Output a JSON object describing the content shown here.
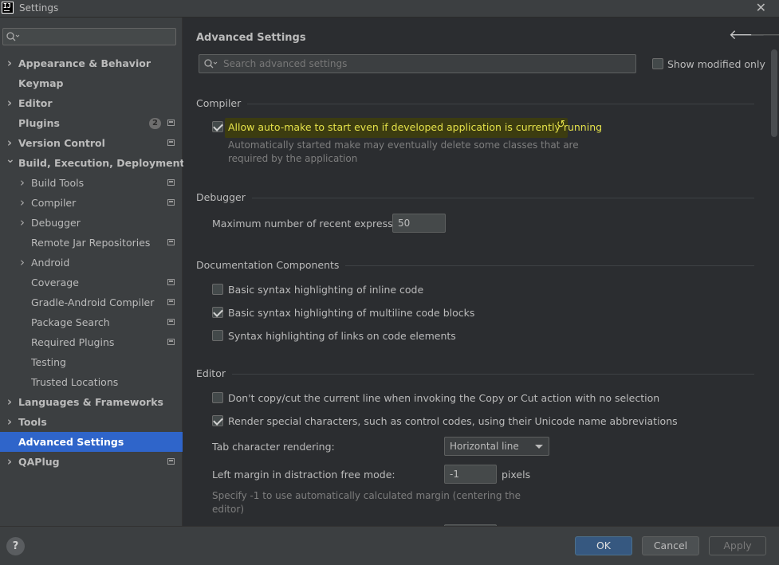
{
  "window": {
    "title": "Settings",
    "icon_text": "IJ"
  },
  "sidebar": {
    "items": [
      {
        "label": "Appearance & Behavior",
        "chevron": "right"
      },
      {
        "label": "Keymap"
      },
      {
        "label": "Editor",
        "chevron": "right"
      },
      {
        "label": "Plugins",
        "badge": "2",
        "project": true
      },
      {
        "label": "Version Control",
        "chevron": "right",
        "project": true
      },
      {
        "label": "Build, Execution, Deployment",
        "chevron": "down"
      },
      {
        "label": "Build Tools",
        "chevron": "right",
        "project": true
      },
      {
        "label": "Compiler",
        "chevron": "right",
        "project": true
      },
      {
        "label": "Debugger",
        "chevron": "right"
      },
      {
        "label": "Remote Jar Repositories",
        "project": true
      },
      {
        "label": "Android",
        "chevron": "right"
      },
      {
        "label": "Coverage",
        "project": true
      },
      {
        "label": "Gradle-Android Compiler",
        "project": true
      },
      {
        "label": "Package Search",
        "project": true
      },
      {
        "label": "Required Plugins",
        "project": true
      },
      {
        "label": "Testing"
      },
      {
        "label": "Trusted Locations"
      },
      {
        "label": "Languages & Frameworks",
        "chevron": "right"
      },
      {
        "label": "Tools",
        "chevron": "right"
      },
      {
        "label": "Advanced Settings",
        "selected": true
      },
      {
        "label": "QAPlug",
        "chevron": "right",
        "project": true
      }
    ]
  },
  "main": {
    "title": "Advanced Settings",
    "search_placeholder": "Search advanced settings",
    "show_modified_label": "Show modified only",
    "sections": {
      "compiler": "Compiler",
      "debugger": "Debugger",
      "documentation": "Documentation Components",
      "editor": "Editor"
    },
    "compiler": {
      "auto_make_label": "Allow auto-make to start even if developed application is currently running",
      "auto_make_hint_1": "Automatically started make may eventually delete some classes that are",
      "auto_make_hint_2": "required by the application"
    },
    "debugger": {
      "max_recent_label": "Maximum number of recent expressions:",
      "max_recent_value": "50"
    },
    "documentation": {
      "inline_label": "Basic syntax highlighting of inline code",
      "multiline_label": "Basic syntax highlighting of multiline code blocks",
      "links_label": "Syntax highlighting of links on code elements"
    },
    "editor": {
      "copy_cut_label": "Don't copy/cut the current line when invoking the Copy or Cut action with no selection",
      "special_chars_label": "Render special characters, such as control codes, using their Unicode name abbreviations",
      "tab_rendering_label": "Tab character rendering:",
      "tab_rendering_value": "Horizontal line",
      "left_margin_label": "Left margin in distraction free mode:",
      "left_margin_value": "-1",
      "left_margin_unit": "pixels",
      "left_margin_hint_1": "Specify -1 to use automatically calculated margin (centering the",
      "left_margin_hint_2": "editor)"
    }
  },
  "footer": {
    "help": "?",
    "ok": "OK",
    "cancel": "Cancel",
    "apply": "Apply"
  },
  "colors": {
    "selected": "#2f65ca",
    "highlight_text": "#e5e24a",
    "ok_button": "#365880"
  }
}
